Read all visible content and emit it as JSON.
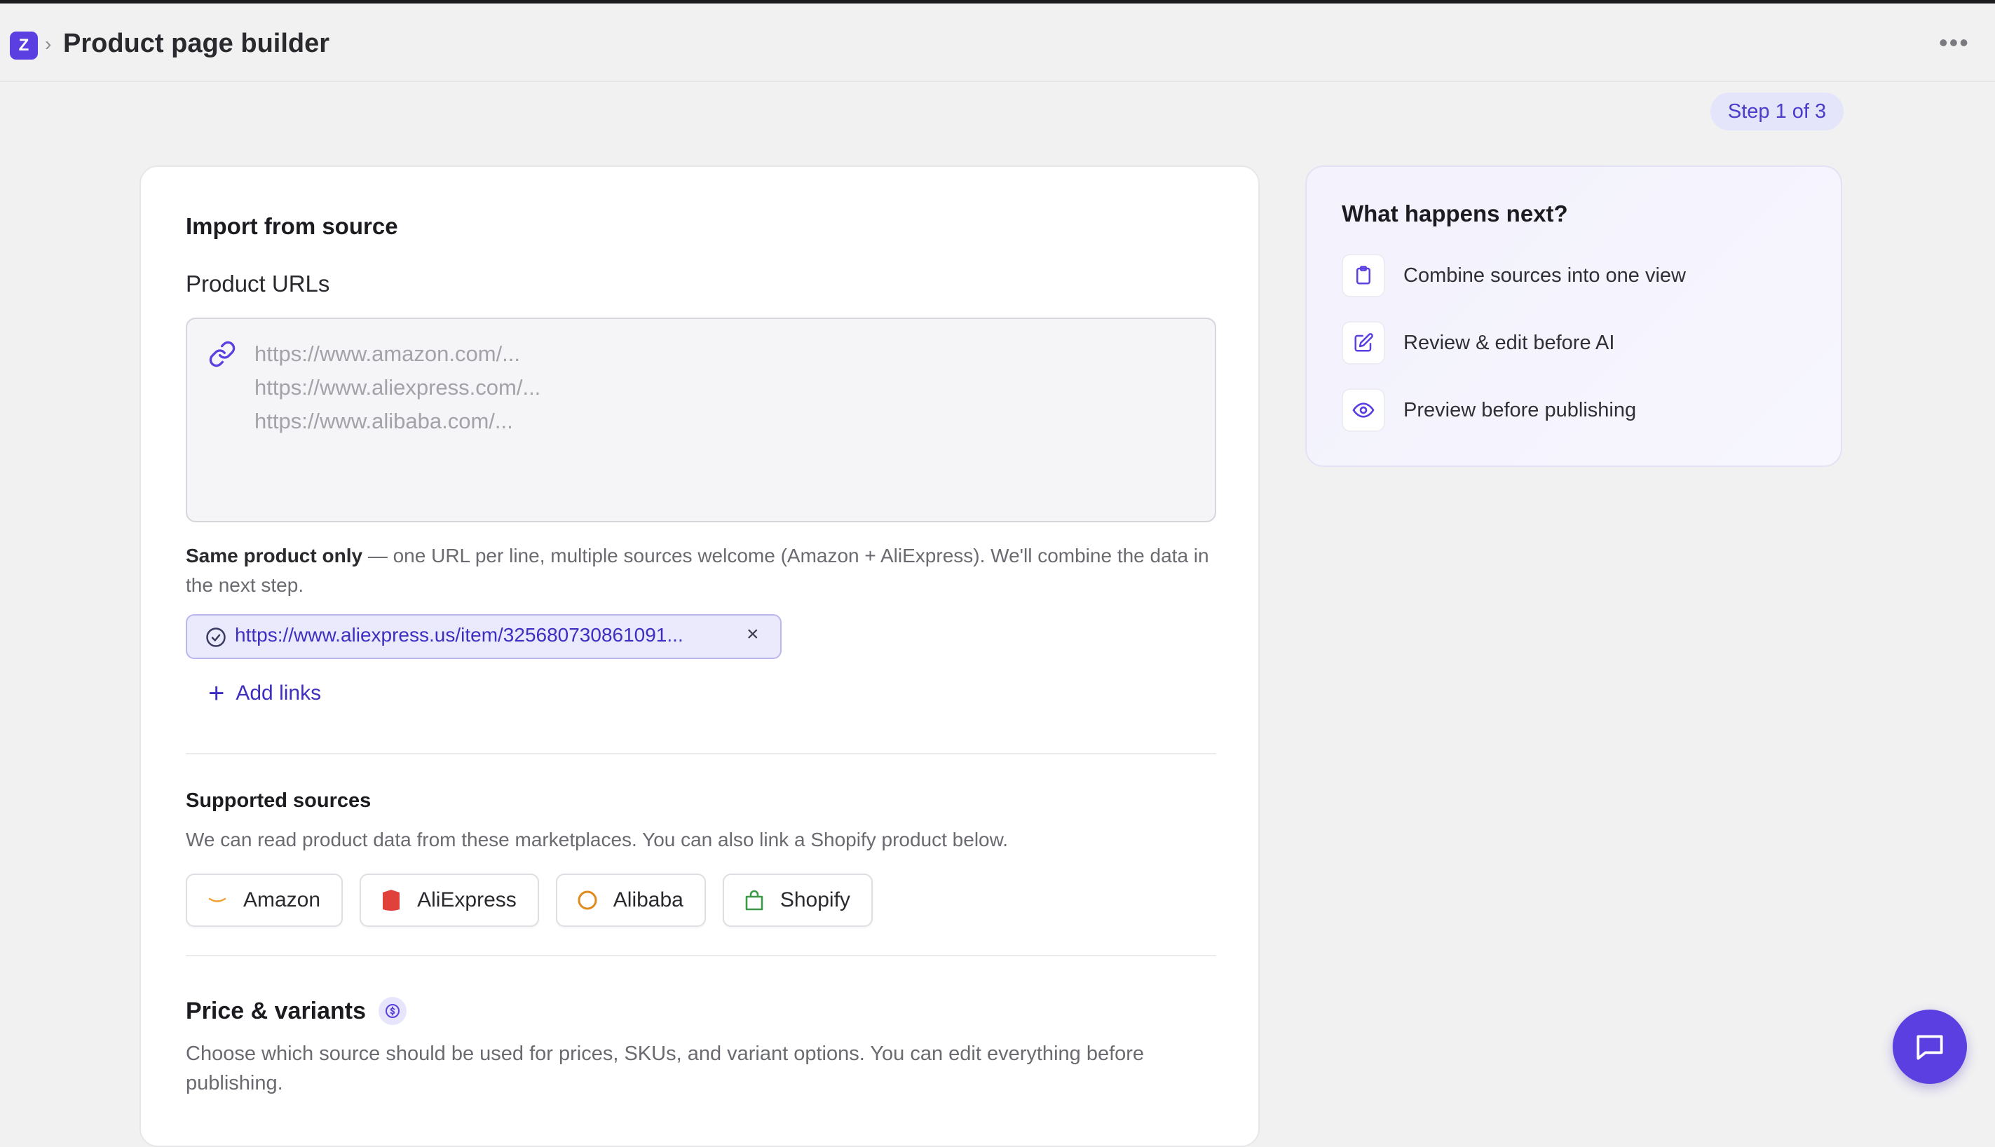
{
  "header": {
    "logo_letter": "Z",
    "separator": "›",
    "title": "Product page builder",
    "more_label": "•••"
  },
  "step_badge": "Step 1 of 3",
  "import": {
    "heading": "Import from source",
    "urls_label": "Product URLs",
    "placeholder": "https://www.amazon.com/...\nhttps://www.aliexpress.com/...\nhttps://www.alibaba.com/...",
    "hint_bold": "Same product only",
    "hint_rest": " — one URL per line, multiple sources welcome (Amazon + AliExpress). We'll combine the data in the next step.",
    "added_url": "https://www.aliexpress.us/item/325680730861091...",
    "remove_label": "×",
    "add_links_label": "Add links"
  },
  "supported": {
    "heading": "Supported sources",
    "description": "We can read product data from these marketplaces. You can also link a Shopify product below.",
    "sources": [
      {
        "name": "Amazon",
        "icon": "amazon-icon",
        "color": "#f0a030"
      },
      {
        "name": "AliExpress",
        "icon": "aliexpress-icon",
        "color": "#e0413a"
      },
      {
        "name": "Alibaba",
        "icon": "alibaba-icon",
        "color": "#e08a1e"
      },
      {
        "name": "Shopify",
        "icon": "shopify-icon",
        "color": "#3c9a47"
      }
    ]
  },
  "price": {
    "heading": "Price & variants",
    "description": "Choose which source should be used for prices, SKUs, and variant options. You can edit everything before publishing."
  },
  "next": {
    "title": "What happens next?",
    "items": [
      {
        "label": "Combine sources into one view",
        "icon": "clipboard-icon"
      },
      {
        "label": "Review & edit before AI",
        "icon": "edit-icon"
      },
      {
        "label": "Preview before publishing",
        "icon": "eye-icon"
      }
    ]
  },
  "colors": {
    "accent": "#5b3fe0",
    "accent_text": "#3e2fc0",
    "background": "#f1f1f2"
  }
}
